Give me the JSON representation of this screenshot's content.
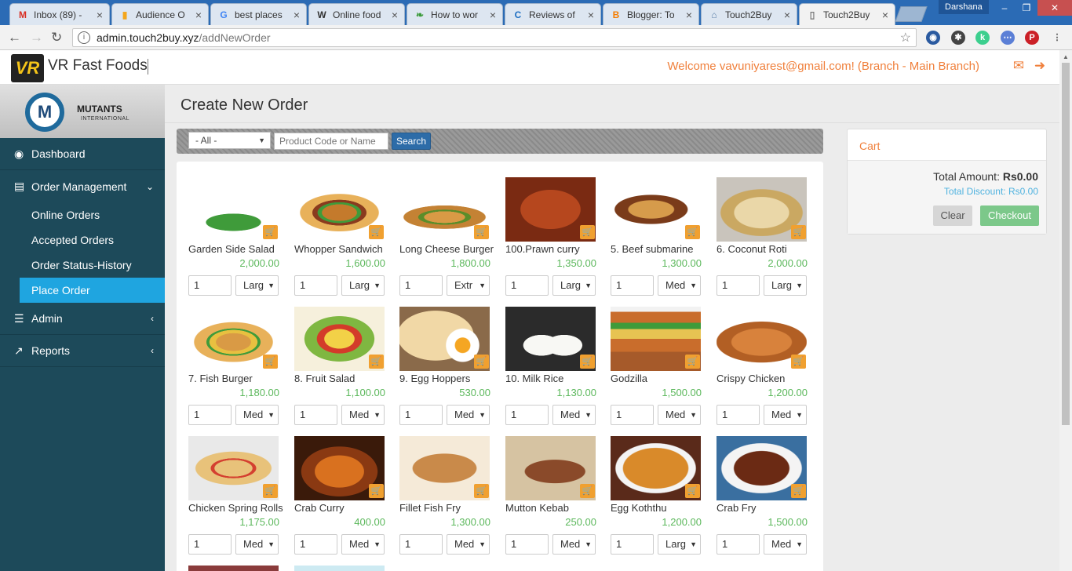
{
  "browser": {
    "tabs": [
      {
        "title": "Inbox (89) -",
        "fav": "M",
        "fav_color": "#d93025",
        "active": false
      },
      {
        "title": "Audience O",
        "fav": "▮",
        "fav_color": "#f4a61c",
        "active": false
      },
      {
        "title": "best places",
        "fav": "G",
        "fav_color": "#4285f4",
        "active": false
      },
      {
        "title": "Online food",
        "fav": "W",
        "fav_color": "#333333",
        "active": false
      },
      {
        "title": "How to wor",
        "fav": "❧",
        "fav_color": "#3a9a3a",
        "active": false
      },
      {
        "title": "Reviews of",
        "fav": "C",
        "fav_color": "#1e6fc2",
        "active": false
      },
      {
        "title": "Blogger: To",
        "fav": "B",
        "fav_color": "#f57d00",
        "active": false
      },
      {
        "title": "Touch2Buy",
        "fav": "⌂",
        "fav_color": "#5a7fa8",
        "active": false
      },
      {
        "title": "Touch2Buy",
        "fav": "▯",
        "fav_color": "#777777",
        "active": true
      }
    ],
    "profile_name": "Darshana",
    "url_host": "admin.touch2buy.xyz",
    "url_path": "/addNewOrder"
  },
  "header": {
    "brand": "VR Fast Foods",
    "logo_text": "VR",
    "welcome": "Welcome vavuniyarest@gmail.com! (Branch - Main Branch)"
  },
  "sidebar": {
    "logo_name": "MUTANTS",
    "logo_sub": "INTERNATIONAL",
    "dashboard": "Dashboard",
    "order_management": "Order Management",
    "online_orders": "Online Orders",
    "accepted_orders": "Accepted Orders",
    "order_status_history": "Order Status-History",
    "place_order": "Place Order",
    "admin": "Admin",
    "reports": "Reports"
  },
  "page": {
    "title": "Create New Order",
    "category_selected": "- All -",
    "search_placeholder": "Product Code or Name",
    "search_button": "Search"
  },
  "products": [
    {
      "name": "Garden Side Salad",
      "price": "2,000.00",
      "qty": "1",
      "size": "Larg"
    },
    {
      "name": "Whopper Sandwich",
      "price": "1,600.00",
      "qty": "1",
      "size": "Larg"
    },
    {
      "name": "Long Cheese Burger",
      "price": "1,800.00",
      "qty": "1",
      "size": "Extr"
    },
    {
      "name": "100.Prawn curry",
      "price": "1,350.00",
      "qty": "1",
      "size": "Larg"
    },
    {
      "name": "5. Beef submarine",
      "price": "1,300.00",
      "qty": "1",
      "size": "Med"
    },
    {
      "name": "6. Coconut Roti",
      "price": "2,000.00",
      "qty": "1",
      "size": "Larg"
    },
    {
      "name": "7. Fish Burger",
      "price": "1,180.00",
      "qty": "1",
      "size": "Med"
    },
    {
      "name": "8. Fruit Salad",
      "price": "1,100.00",
      "qty": "1",
      "size": "Med"
    },
    {
      "name": "9. Egg Hoppers",
      "price": "530.00",
      "qty": "1",
      "size": "Med"
    },
    {
      "name": "10. Milk Rice",
      "price": "1,130.00",
      "qty": "1",
      "size": "Med"
    },
    {
      "name": "Godzilla",
      "price": "1,500.00",
      "qty": "1",
      "size": "Med"
    },
    {
      "name": "Crispy Chicken",
      "price": "1,200.00",
      "qty": "1",
      "size": "Med"
    },
    {
      "name": "Chicken Spring Rolls",
      "price": "1,175.00",
      "qty": "1",
      "size": "Med"
    },
    {
      "name": "Crab Curry",
      "price": "400.00",
      "qty": "1",
      "size": "Med"
    },
    {
      "name": "Fillet Fish Fry",
      "price": "1,300.00",
      "qty": "1",
      "size": "Med"
    },
    {
      "name": "Mutton Kebab",
      "price": "250.00",
      "qty": "1",
      "size": "Med"
    },
    {
      "name": "Egg Koththu",
      "price": "1,200.00",
      "qty": "1",
      "size": "Larg"
    },
    {
      "name": "Crab Fry",
      "price": "1,500.00",
      "qty": "1",
      "size": "Med"
    }
  ],
  "cart": {
    "title": "Cart",
    "total_label": "Total Amount:",
    "total_value": "Rs0.00",
    "discount_label": "Total Discount:",
    "discount_value": "Rs0.00",
    "clear": "Clear",
    "checkout": "Checkout"
  },
  "colors": {
    "sidebar_bg": "#1d4a5a",
    "accent_orange": "#f0803c",
    "active_blue": "#1fa5e0",
    "price_green": "#5cb85c",
    "checkout_green": "#7cc88a"
  }
}
